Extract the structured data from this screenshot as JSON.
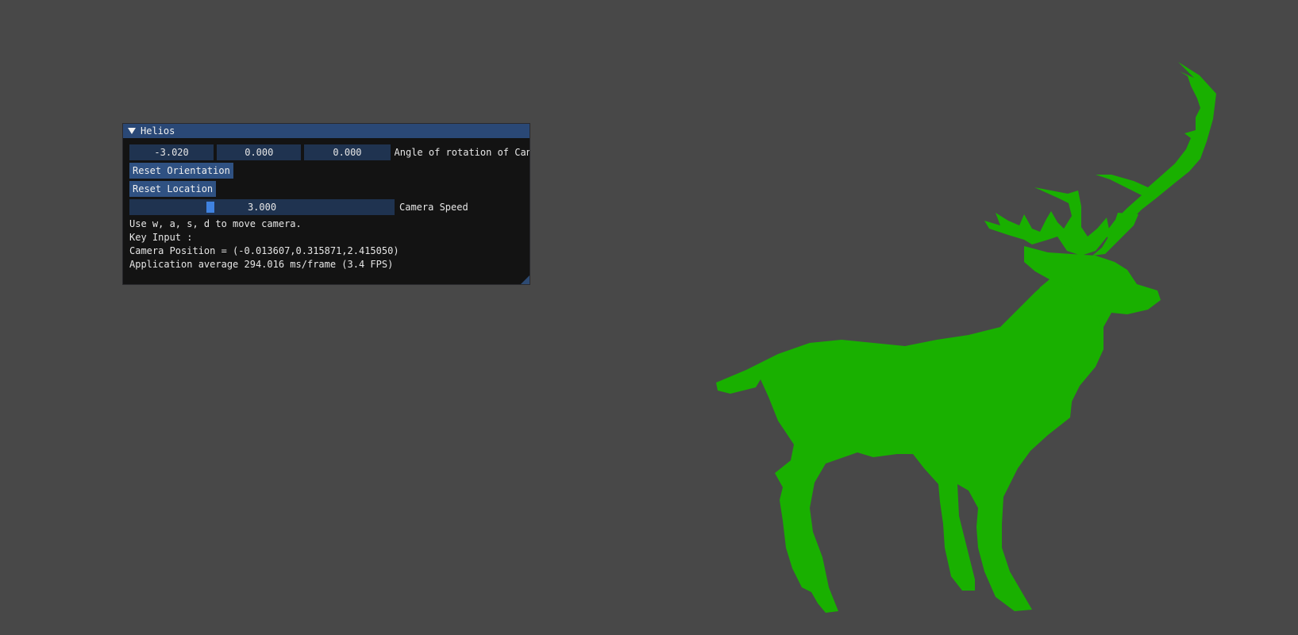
{
  "window": {
    "title": "Helios"
  },
  "controls": {
    "rotation_values": [
      "-3.020",
      "0.000",
      "0.000"
    ],
    "rotation_label": "Angle of rotation of Can",
    "reset_orientation_label": "Reset Orientation",
    "reset_location_label": "Reset Location",
    "camera_speed_value": "3.000",
    "camera_speed_fraction": 0.3,
    "camera_speed_label": "Camera Speed"
  },
  "info": {
    "move_hint": "Use w, a, s, d to move camera.",
    "key_input": "Key Input :",
    "camera_position": "Camera Position = (-0.013607,0.315871,2.415050)",
    "fps": "Application average 294.016 ms/frame (3.4 FPS)"
  },
  "colors": {
    "background": "#484848",
    "model": "#19b000",
    "title_bar": "#2a4876",
    "frame": "#1f3350",
    "button": "#2f5182",
    "slider_grab": "#3f82e0"
  },
  "scene": {
    "model_icon": "deer-silhouette"
  }
}
